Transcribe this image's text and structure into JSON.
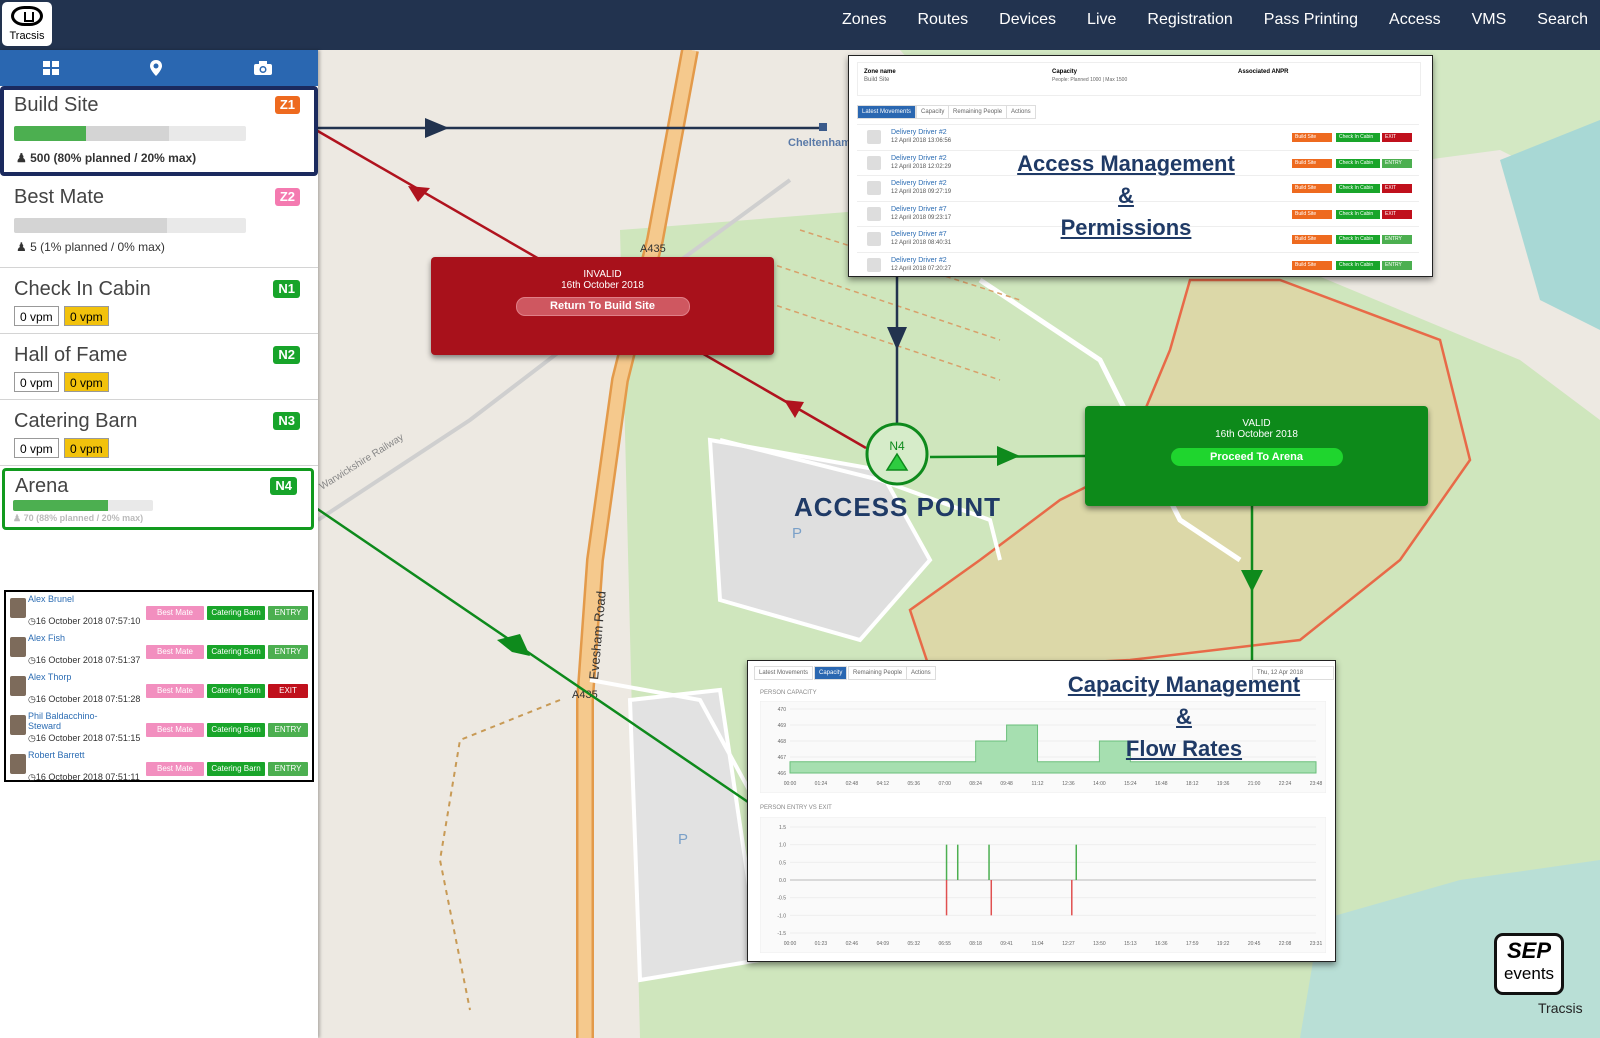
{
  "app": {
    "logo_text": "Tracsis"
  },
  "nav": {
    "items": [
      "Zones",
      "Routes",
      "Devices",
      "Live",
      "Registration",
      "Pass Printing",
      "Access",
      "VMS",
      "Search"
    ]
  },
  "sidebar": {
    "tabs": [
      "grid-icon",
      "map-pin-icon",
      "camera-icon"
    ],
    "zones": [
      {
        "name": "Build Site",
        "badge": "Z1",
        "badge_color": "#ee6a1f",
        "caption": "500 (80% planned / 20% max)",
        "planned": 0.31,
        "max": 0.67
      },
      {
        "name": "Best Mate",
        "badge": "Z2",
        "badge_color": "#f47ab0",
        "caption": "5 (1% planned / 0% max)",
        "planned": 0.0,
        "max": 0.66
      },
      {
        "name": "Check In Cabin",
        "badge": "N1",
        "badge_color": "#17a42a",
        "vpm": [
          "0 vpm",
          "0 vpm"
        ]
      },
      {
        "name": "Hall of Fame",
        "badge": "N2",
        "badge_color": "#17a42a",
        "vpm": [
          "0 vpm",
          "0 vpm"
        ]
      },
      {
        "name": "Catering Barn",
        "badge": "N3",
        "badge_color": "#17a42a",
        "vpm": [
          "0 vpm",
          "0 vpm"
        ]
      },
      {
        "name": "Arena",
        "badge": "N4",
        "badge_color": "#17a42a",
        "caption": "70 (88% planned / 20% max)",
        "planned": 0.68,
        "max": 0.0
      }
    ]
  },
  "movements": [
    {
      "name": "Alex Brunel",
      "time": "16 October 2018 07:57:10",
      "from": "Best Mate",
      "to": "Catering Barn",
      "dir": "ENTRY"
    },
    {
      "name": "Alex Fish",
      "time": "16 October 2018 07:51:37",
      "from": "Best Mate",
      "to": "Catering Barn",
      "dir": "ENTRY"
    },
    {
      "name": "Alex Thorp",
      "time": "16 October 2018 07:51:28",
      "from": "Best Mate",
      "to": "Catering Barn",
      "dir": "EXIT"
    },
    {
      "name": "Phil Baldacchino-Steward",
      "time": "16 October 2018 07:51:15",
      "from": "Best Mate",
      "to": "Catering Barn",
      "dir": "ENTRY"
    },
    {
      "name": "Robert Barrett",
      "time": "16 October 2018 07:51:11",
      "from": "Best Mate",
      "to": "Catering Barn",
      "dir": "ENTRY"
    }
  ],
  "invalid": {
    "status": "INVALID",
    "date": "16th October 2018",
    "action": "Return To Build Site"
  },
  "valid": {
    "status": "VALID",
    "date": "16th October 2018",
    "action": "Proceed To Arena"
  },
  "access_point": {
    "title": "ACCESS POINT",
    "node": "N4"
  },
  "access_panel": {
    "headers": [
      "Zone name",
      "Capacity",
      "Associated ANPR"
    ],
    "zone": "Build Site",
    "capacity": "People: Planned 1000 | Max 1500",
    "tabs": [
      "Latest Movements",
      "Capacity",
      "Remaining People",
      "Actions"
    ],
    "title_lines": [
      "Access Management",
      "&",
      "Permissions"
    ],
    "rows": [
      {
        "name": "Delivery Driver #2",
        "time": "12 April 2018 13:06:56",
        "dir": "EXIT"
      },
      {
        "name": "Delivery Driver #2",
        "time": "12 April 2018 12:02:29",
        "dir": "ENTRY"
      },
      {
        "name": "Delivery Driver #2",
        "time": "12 April 2018 09:27:19",
        "dir": "EXIT"
      },
      {
        "name": "Delivery Driver #7",
        "time": "12 April 2018 09:23:17",
        "dir": "EXIT"
      },
      {
        "name": "Delivery Driver #7",
        "time": "12 April 2018 08:40:31",
        "dir": "ENTRY"
      },
      {
        "name": "Delivery Driver #2",
        "time": "12 April 2018 07:20:27",
        "dir": "ENTRY"
      }
    ],
    "row_tags": [
      "Build Site",
      "Check In Cabin"
    ]
  },
  "capacity_panel": {
    "tabs": [
      "Latest Movements",
      "Capacity",
      "Remaining People",
      "Actions"
    ],
    "date": "Thu, 12 Apr 2018",
    "title_lines": [
      "Capacity Management",
      "&",
      "Flow Rates"
    ],
    "chart1_label": "PERSON CAPACITY",
    "chart2_label": "PERSON ENTRY VS EXIT"
  },
  "map_labels": {
    "road": "Evesham Road",
    "a435": "A435",
    "railway": "Warwickshire Railway",
    "racecourse": "Cheltenham Racecourse"
  },
  "sep_logo": {
    "line1": "SEP",
    "line2": "events",
    "credit": "Tracsis"
  },
  "chart_data": [
    {
      "type": "area",
      "title": "PERSON CAPACITY",
      "x": [
        "00:00",
        "01:24",
        "02:48",
        "04:12",
        "05:36",
        "07:00",
        "08:24",
        "09:48",
        "11:12",
        "12:36",
        "14:00",
        "15:24",
        "16:48",
        "18:12",
        "19:36",
        "21:00",
        "22:24",
        "23:48"
      ],
      "ylabels": [
        "466",
        "467",
        "468",
        "469",
        "470"
      ],
      "ylim": [
        466,
        470
      ],
      "series": [
        {
          "values": [
            466.7,
            466.7,
            466.7,
            466.7,
            466.7,
            466.7,
            468.0,
            469.0,
            466.7,
            466.7,
            468.0,
            466.7,
            466.7,
            466.7,
            466.7,
            466.7,
            466.7,
            466.7
          ]
        }
      ],
      "color": "#a6dfb0"
    },
    {
      "type": "bar",
      "title": "PERSON ENTRY VS EXIT",
      "x": [
        "00:00",
        "01:23",
        "02:46",
        "04:09",
        "05:32",
        "06:55",
        "08:18",
        "09:41",
        "11:04",
        "12:27",
        "13:50",
        "15:13",
        "16:36",
        "17:59",
        "19:22",
        "20:45",
        "22:08",
        "23:31"
      ],
      "ylabels": [
        "1.5",
        "1.0",
        "0.5",
        "0.0",
        "-0.5",
        "-1.0",
        "-1.5"
      ],
      "ylim": [
        -1.5,
        1.5
      ],
      "series": [
        {
          "values": [
            {
              "x": 7.0,
              "v": 1.0
            },
            {
              "x": 7.5,
              "v": 1.0
            },
            {
              "x": 8.9,
              "v": 1.0
            },
            {
              "x": 12.8,
              "v": 1.0
            }
          ],
          "color": "#4caf50"
        },
        {
          "values": [
            {
              "x": 7.0,
              "v": -1.0
            },
            {
              "x": 9.0,
              "v": -1.0
            },
            {
              "x": 12.6,
              "v": -1.0
            }
          ],
          "color": "#e05050"
        }
      ]
    }
  ]
}
